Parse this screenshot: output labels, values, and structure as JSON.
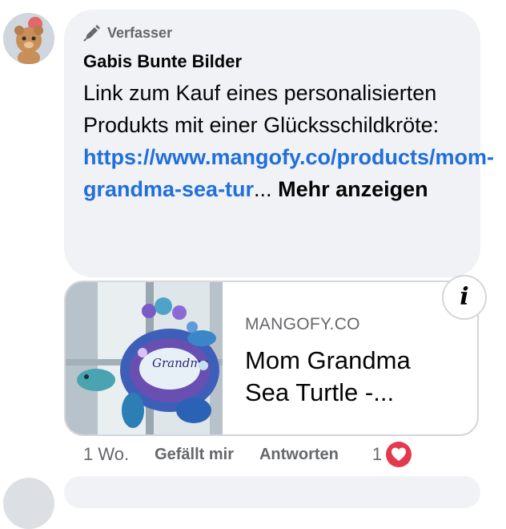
{
  "comment": {
    "author_badge": "Verfasser",
    "author_name": "Gabis Bunte Bilder",
    "text_before_link": "Link zum Kauf eines personalisierten Produkts mit einer Glücksschildkröte: ",
    "link_text": "https://www.mangofy.co/products/mom-grandma-sea-tur",
    "ellipsis": "...",
    "more_label": "Mehr anzeigen"
  },
  "link_preview": {
    "domain": "MANGOFY.CO",
    "title": "Mom Grandma Sea Turtle -...",
    "thumbnail_lettering": "Grandma"
  },
  "actions": {
    "time": "1 Wo.",
    "like_label": "Gefällt mir",
    "reply_label": "Antworten",
    "reaction_count": "1"
  },
  "icons": {
    "badge": "pencil-icon",
    "info": "info-icon",
    "reaction": "heart-icon"
  },
  "colors": {
    "bubble": "#f0f2f5",
    "link": "#216fdb",
    "secondary_text": "#65676b",
    "heart": "#e4394b"
  }
}
